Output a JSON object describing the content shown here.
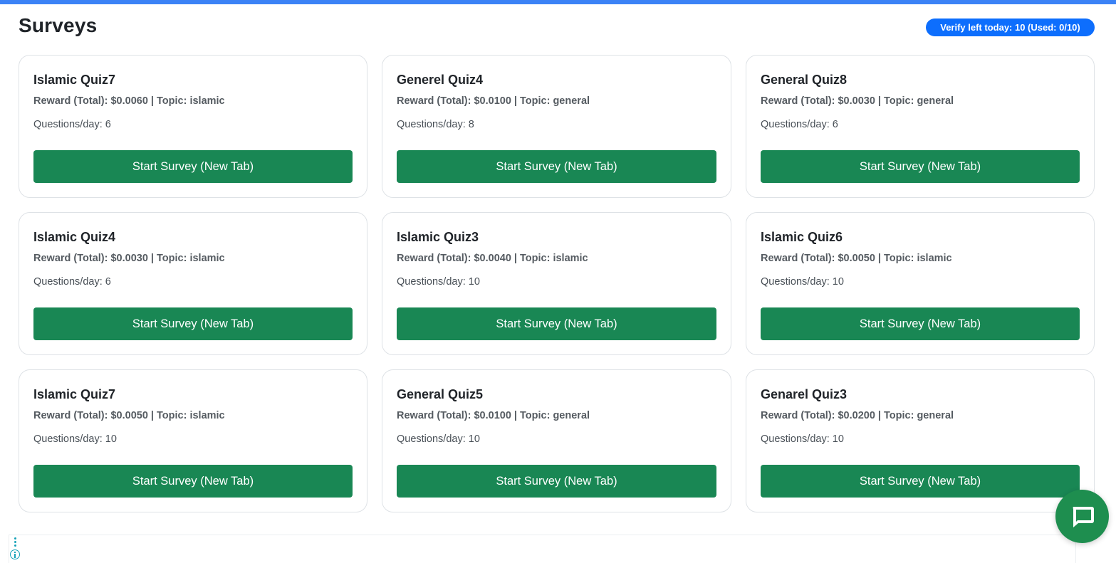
{
  "header": {
    "title": "Surveys",
    "verify_badge": "Verify left today: 10 (Used: 0/10)"
  },
  "surveys": [
    {
      "title": "Islamic Quiz7",
      "meta": "Reward (Total): $0.0060 | Topic: islamic",
      "questions": "Questions/day: 6",
      "button": "Start Survey (New Tab)"
    },
    {
      "title": "Generel Quiz4",
      "meta": "Reward (Total): $0.0100 | Topic: general",
      "questions": "Questions/day: 8",
      "button": "Start Survey (New Tab)"
    },
    {
      "title": "General Quiz8",
      "meta": "Reward (Total): $0.0030 | Topic: general",
      "questions": "Questions/day: 6",
      "button": "Start Survey (New Tab)"
    },
    {
      "title": "Islamic Quiz4",
      "meta": "Reward (Total): $0.0030 | Topic: islamic",
      "questions": "Questions/day: 6",
      "button": "Start Survey (New Tab)"
    },
    {
      "title": "Islamic Quiz3",
      "meta": "Reward (Total): $0.0040 | Topic: islamic",
      "questions": "Questions/day: 10",
      "button": "Start Survey (New Tab)"
    },
    {
      "title": "Islamic Quiz6",
      "meta": "Reward (Total): $0.0050 | Topic: islamic",
      "questions": "Questions/day: 10",
      "button": "Start Survey (New Tab)"
    },
    {
      "title": "Islamic Quiz7",
      "meta": "Reward (Total): $0.0050 | Topic: islamic",
      "questions": "Questions/day: 10",
      "button": "Start Survey (New Tab)"
    },
    {
      "title": "General Quiz5",
      "meta": "Reward (Total): $0.0100 | Topic: general",
      "questions": "Questions/day: 10",
      "button": "Start Survey (New Tab)"
    },
    {
      "title": "Genarel Quiz3",
      "meta": "Reward (Total): $0.0200 | Topic: general",
      "questions": "Questions/day: 10",
      "button": "Start Survey (New Tab)"
    }
  ],
  "colors": {
    "accent_bar": "#3b82f6",
    "badge": "#0d6efd",
    "button": "#198754",
    "chat": "#1e8e4f"
  },
  "icons": {
    "chat": "chat-bubble-icon",
    "kebab": "kebab-menu-icon",
    "info": "info-icon"
  }
}
